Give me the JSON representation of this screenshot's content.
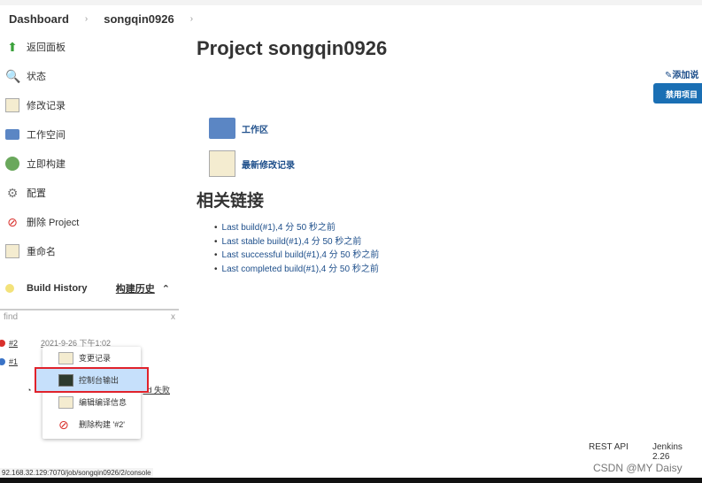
{
  "breadcrumb": [
    "Dashboard",
    "songqin0926"
  ],
  "sidebar": {
    "items": [
      {
        "label": "返回面板",
        "icon": "up-arrow-icon"
      },
      {
        "label": "状态",
        "icon": "search-icon"
      },
      {
        "label": "修改记录",
        "icon": "notepad-icon"
      },
      {
        "label": "工作空间",
        "icon": "folder-icon"
      },
      {
        "label": "立即构建",
        "icon": "build-icon"
      },
      {
        "label": "配置",
        "icon": "gear-icon"
      },
      {
        "label": "删除 Project",
        "icon": "no-icon"
      },
      {
        "label": "重命名",
        "icon": "notepad-icon"
      }
    ]
  },
  "build_history": {
    "title": "Build History",
    "trend": "构建历史",
    "find_placeholder": "find",
    "clear": "x",
    "builds": [
      {
        "id": "#2",
        "time": "2021-9-26 下午1:02",
        "status_color": "#d9302c"
      },
      {
        "id": "#1",
        "time": "",
        "status_color": "#3a73c6"
      }
    ],
    "feed_fragment": "ed 失败"
  },
  "context_menu": {
    "items": [
      "变更记录",
      "控制台输出",
      "编辑编译信息",
      "删除构建 '#2'"
    ],
    "selected": 1
  },
  "main": {
    "title": "Project songqin0926",
    "add_description": "添加说",
    "disable_button": "禁用项目",
    "workspace_link": "工作区",
    "changes_link": "最新修改记录",
    "related_title": "相关链接",
    "links": [
      "Last build(#1),4 分 50 秒之前",
      "Last stable build(#1),4 分 50 秒之前",
      "Last successful build(#1),4 分 50 秒之前",
      "Last completed build(#1),4 分 50 秒之前"
    ]
  },
  "footer": {
    "rest_api": "REST API",
    "version": "Jenkins 2.26"
  },
  "status_url": "92.168.32.129:7070/job/songqin0926/2/console",
  "watermark": "CSDN @MY Daisy"
}
